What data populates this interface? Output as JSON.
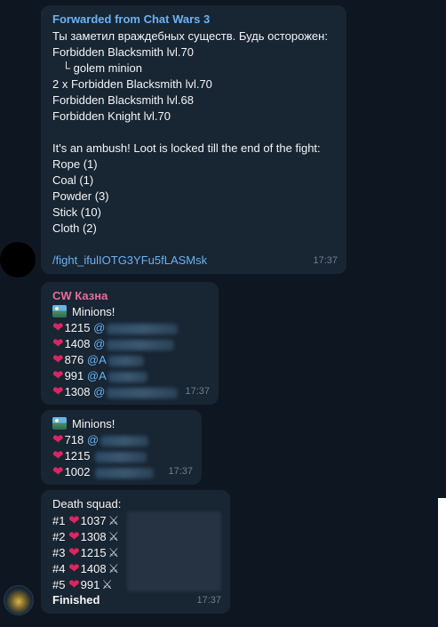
{
  "msg1": {
    "forwarded_from": "Forwarded from Chat Wars 3",
    "lines": [
      "Ты заметил враждебных существ. Будь осторожен:",
      "Forbidden Blacksmith lvl.70",
      "   └ golem minion",
      "2 x Forbidden Blacksmith lvl.70",
      "Forbidden Blacksmith lvl.68",
      "Forbidden Knight lvl.70",
      "",
      "It's an ambush! Loot is locked till the end of the fight:",
      "Rope (1)",
      "Coal (1)",
      "Powder (3)",
      "Stick (10)",
      "Cloth (2)"
    ],
    "command": "/fight_ifulIOTG3YFu5fLASMsk",
    "time": "17:37"
  },
  "msg2": {
    "sender": "CW Казна",
    "title": "Minions!",
    "rows": [
      {
        "hp": "1215",
        "at": "@"
      },
      {
        "hp": "1408",
        "at": "@"
      },
      {
        "hp": "876",
        "at": "@A"
      },
      {
        "hp": "991",
        "at": "@A"
      },
      {
        "hp": "1308",
        "at": "@"
      }
    ],
    "time": "17:37"
  },
  "msg3": {
    "title": "Minions!",
    "rows": [
      {
        "hp": "718",
        "at": "@"
      },
      {
        "hp": "1215",
        "at": ""
      },
      {
        "hp": "1002",
        "at": ""
      }
    ],
    "time": "17:37"
  },
  "msg4": {
    "title": "Death squad:",
    "rows": [
      {
        "rank": "#1",
        "hp": "1037"
      },
      {
        "rank": "#2",
        "hp": "1308"
      },
      {
        "rank": "#3",
        "hp": "1215"
      },
      {
        "rank": "#4",
        "hp": "1408"
      },
      {
        "rank": "#5",
        "hp": "991"
      }
    ],
    "footer": "Finished",
    "time": "17:37"
  },
  "colors": {
    "background": "#0e1621",
    "bubble": "#182533",
    "link": "#6ab3f3",
    "sender_name": "#e56d9a",
    "heart": "#e0245e"
  }
}
